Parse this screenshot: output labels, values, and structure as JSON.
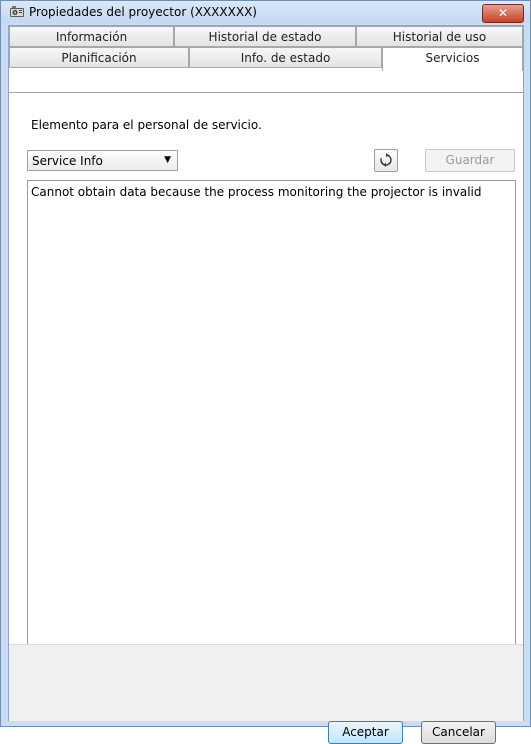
{
  "window": {
    "title": "Propiedades del proyector (XXXXXXX)",
    "close_icon": "close-icon",
    "app_icon": "projector-icon"
  },
  "tabs": {
    "row1": [
      "Información",
      "Historial de estado",
      "Historial de uso"
    ],
    "row2": [
      "Planificación",
      "Info. de estado",
      "Servicios"
    ],
    "active": "Servicios"
  },
  "services": {
    "description": "Elemento para el personal de servicio.",
    "dropdown_value": "Service Info",
    "refresh_icon": "refresh-icon",
    "save_label": "Guardar",
    "output_text": "Cannot obtain data because the process monitoring the projector is invalid"
  },
  "footer": {
    "ok_label": "Aceptar",
    "cancel_label": "Cancelar"
  },
  "colors": {
    "frame": "#c9dcf3",
    "close": "#c4432a",
    "ok_button": "#bee6fd"
  }
}
